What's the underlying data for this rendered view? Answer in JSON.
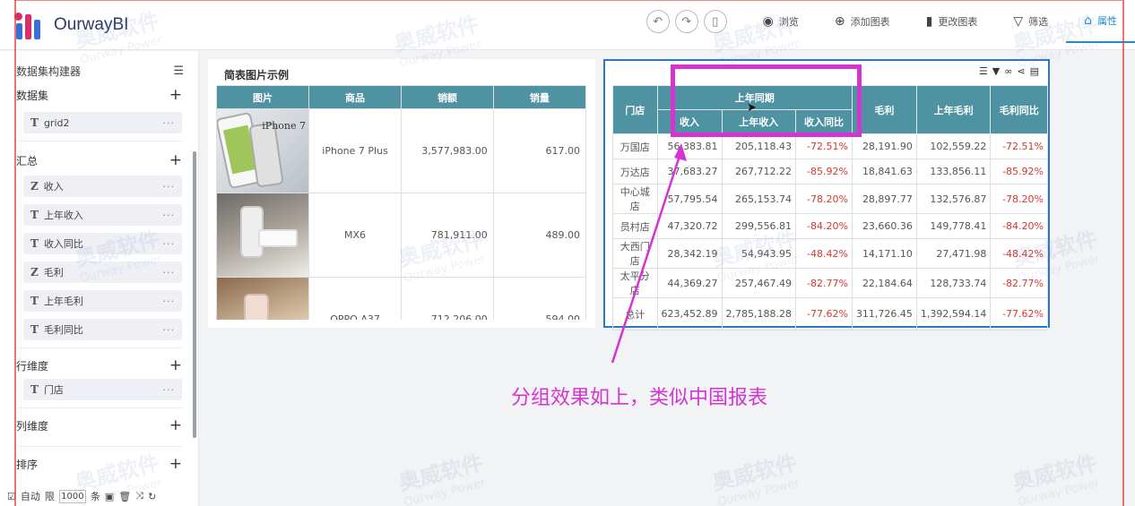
{
  "app": {
    "logo_text": "OurwayBI"
  },
  "toolbar": {
    "undo_icon": "undo-icon",
    "redo_icon": "redo-icon",
    "mobile_icon": "mobile-icon",
    "preview": "浏览",
    "add_chart": "添加图表",
    "change_chart": "更改图表",
    "filter": "筛选",
    "properties": "属性"
  },
  "sidebar": {
    "title": "数据集构建器",
    "dataset_label": "数据集",
    "dataset_field": "grid2",
    "summary_label": "汇总",
    "summary_fields": [
      {
        "type": "Z",
        "name": "收入"
      },
      {
        "type": "T",
        "name": "上年收入"
      },
      {
        "type": "T",
        "name": "收入同比"
      },
      {
        "type": "Z",
        "name": "毛利"
      },
      {
        "type": "T",
        "name": "上年毛利"
      },
      {
        "type": "T",
        "name": "毛利同比"
      }
    ],
    "row_dim_label": "行维度",
    "row_dim_field": "门店",
    "col_dim_label": "列维度",
    "sort_label": "排序",
    "footer": {
      "auto": "自动",
      "limit": "限",
      "limit_value": "1000",
      "unit": "条"
    }
  },
  "card1": {
    "title": "简表图片示例",
    "headers": [
      "图片",
      "商品",
      "销额",
      "销量"
    ],
    "rows": [
      {
        "product": "iPhone 7 Plus",
        "sales": "3,577,983.00",
        "qty": "617.00",
        "img_label": "iPhone 7"
      },
      {
        "product": "MX6",
        "sales": "781,911.00",
        "qty": "489.00",
        "img_label": ""
      },
      {
        "product": "OPPO A37",
        "sales": "712,206.00",
        "qty": "594.00",
        "img_label": ""
      }
    ]
  },
  "card2": {
    "header_store": "门店",
    "header_group": "上年同期",
    "header_sub": [
      "收入",
      "上年收入",
      "收入同比"
    ],
    "header_rest": [
      "毛利",
      "上年毛利",
      "毛利同比"
    ],
    "rows": [
      [
        "万国店",
        "56,383.81",
        "205,118.43",
        "-72.51%",
        "28,191.90",
        "102,559.22",
        "-72.51%"
      ],
      [
        "万达店",
        "37,683.27",
        "267,712.22",
        "-85.92%",
        "18,841.63",
        "133,856.11",
        "-85.92%"
      ],
      [
        "中心城店",
        "57,795.54",
        "265,153.74",
        "-78.20%",
        "28,897.77",
        "132,576.87",
        "-78.20%"
      ],
      [
        "员村店",
        "47,320.72",
        "299,556.81",
        "-84.20%",
        "23,660.36",
        "149,778.41",
        "-84.20%"
      ],
      [
        "大西门店",
        "28,342.19",
        "54,943.95",
        "-48.42%",
        "14,171.10",
        "27,471.98",
        "-48.42%"
      ],
      [
        "太平分店",
        "44,369.27",
        "257,467.49",
        "-82.77%",
        "22,184.64",
        "128,733.74",
        "-82.77%"
      ],
      [
        "总计",
        "623,452.89",
        "2,785,188.28",
        "-77.62%",
        "311,726.45",
        "1,392,594.14",
        "-77.62%"
      ]
    ]
  },
  "annotation": "分组效果如上，类似中国报表",
  "watermark": {
    "cn": "奥威软件",
    "en": "Ourway Power"
  }
}
